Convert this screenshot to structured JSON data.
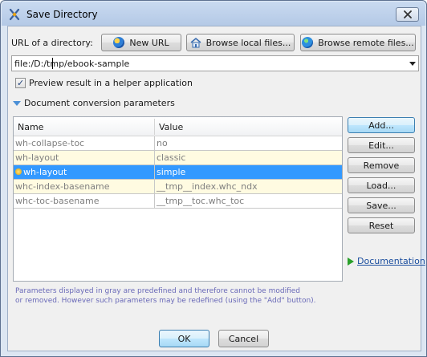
{
  "window": {
    "title": "Save Directory"
  },
  "url_row": {
    "label": "URL of a directory:",
    "new_url_label": "New URL",
    "browse_local_label": "Browse local files...",
    "browse_remote_label": "Browse remote files...",
    "value": "file:/D:/tmp/ebook-sample"
  },
  "preview": {
    "label": "Preview result in a helper application",
    "checked": true
  },
  "section": {
    "label": "Document conversion parameters"
  },
  "table": {
    "columns": [
      "Name",
      "Value"
    ],
    "rows": [
      {
        "name": "wh-collapse-toc",
        "value": "no",
        "state": "predefined"
      },
      {
        "name": "wh-layout",
        "value": "classic",
        "state": "redefined"
      },
      {
        "name": "wh-layout",
        "value": "simple",
        "state": "selected"
      },
      {
        "name": "whc-index-basename",
        "value": "__tmp__index.whc_ndx",
        "state": "redefined"
      },
      {
        "name": "whc-toc-basename",
        "value": "__tmp__toc.whc_toc",
        "state": "normal"
      }
    ]
  },
  "side_buttons": {
    "add": "Add...",
    "edit": "Edit...",
    "remove": "Remove",
    "load": "Load...",
    "save": "Save...",
    "reset": "Reset"
  },
  "documentation_link": "Documentation",
  "note": {
    "line1": "Parameters displayed in gray are predefined and therefore cannot be modified",
    "line2": "or removed. However such parameters may be redefined (using the \"Add\" button)."
  },
  "footer": {
    "ok": "OK",
    "cancel": "Cancel"
  },
  "colors": {
    "selection": "#3399ff",
    "redefined_row": "#fffbe1",
    "predefined_text": "#808080",
    "link": "#1a4d9e"
  }
}
